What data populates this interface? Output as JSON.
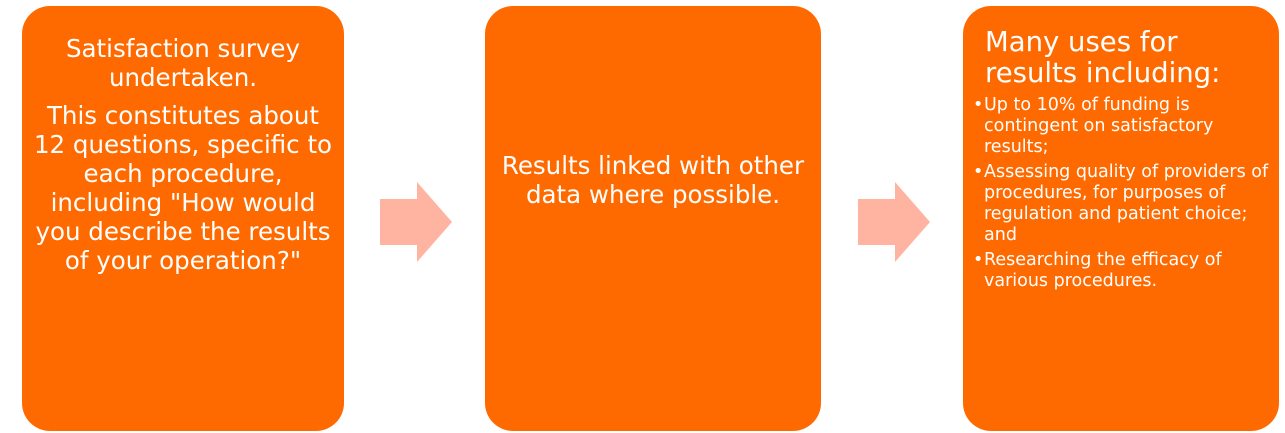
{
  "steps": [
    {
      "paragraphs": [
        "Satisfaction survey undertaken.",
        "This constitutes about 12 questions, specific to each procedure, including \"How would you describe the results of your operation?\""
      ]
    },
    {
      "text": "Results linked with other data where possible."
    },
    {
      "heading": "Many uses for results including:",
      "bullets": [
        "Up to 10% of funding is contingent on satisfactory results;",
        "Assessing quality of providers of procedures, for purposes of regulation and patient choice; and",
        "Researching the efficacy of various procedures."
      ]
    }
  ],
  "colors": {
    "box": "#ff6a00",
    "arrow": "#ffb3a1",
    "text": "#ffffff"
  },
  "icons": {
    "arrow": "right-arrow-icon",
    "bullet": "•"
  }
}
